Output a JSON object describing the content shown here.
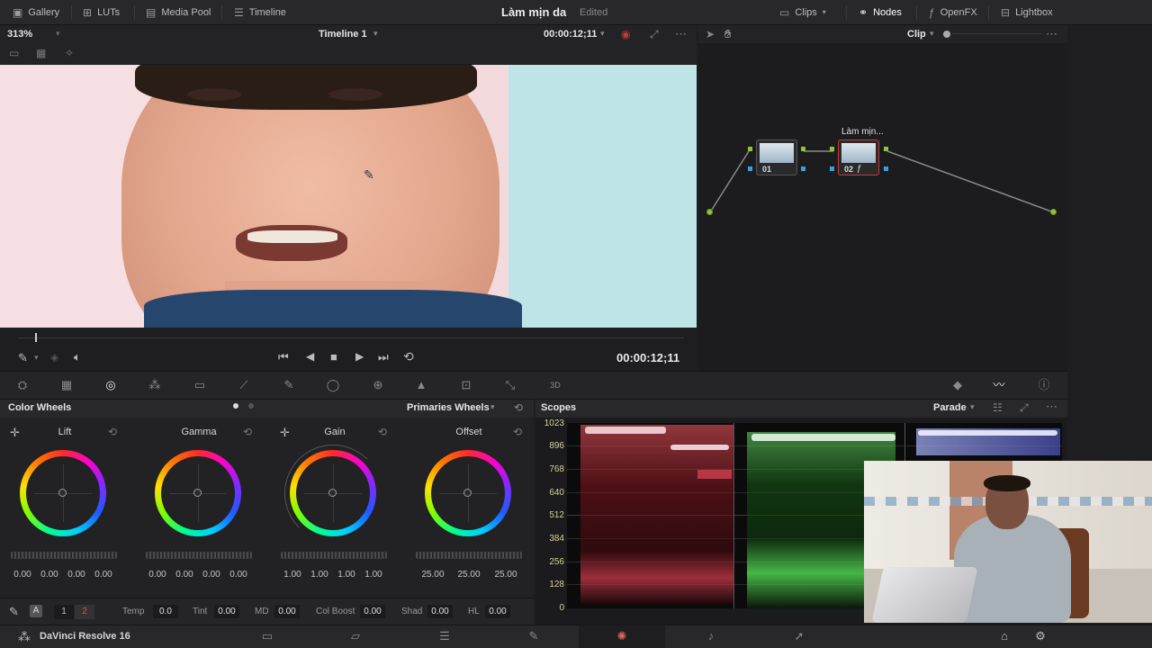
{
  "topbar": {
    "gallery": "Gallery",
    "luts": "LUTs",
    "media_pool": "Media Pool",
    "timeline": "Timeline",
    "project_title": "Làm mịn da",
    "edited": "Edited",
    "clips": "Clips",
    "nodes": "Nodes",
    "openfx": "OpenFX",
    "lightbox": "Lightbox"
  },
  "viewer": {
    "zoom": "313%",
    "timeline_name": "Timeline 1",
    "timecode_top": "00:00:12;11",
    "timecode": "00:00:12;11"
  },
  "nodes": {
    "mode": "Clip",
    "node1_label": "01",
    "node2_label": "02",
    "node2_title": "Làm mịn..."
  },
  "color_wheels": {
    "title": "Color Wheels",
    "mode": "Primaries Wheels",
    "wheels": [
      {
        "name": "Lift",
        "values": [
          "0.00",
          "0.00",
          "0.00",
          "0.00"
        ]
      },
      {
        "name": "Gamma",
        "values": [
          "0.00",
          "0.00",
          "0.00",
          "0.00"
        ]
      },
      {
        "name": "Gain",
        "values": [
          "1.00",
          "1.00",
          "1.00",
          "1.00"
        ]
      },
      {
        "name": "Offset",
        "values": [
          "25.00",
          "25.00",
          "25.00"
        ]
      }
    ]
  },
  "footer_params": {
    "page1": "1",
    "page2": "2",
    "temp_label": "Temp",
    "temp": "0.0",
    "tint_label": "Tint",
    "tint": "0.00",
    "md_label": "MD",
    "md": "0.00",
    "colboost_label": "Col Boost",
    "colboost": "0.00",
    "shad_label": "Shad",
    "shad": "0.00",
    "hl_label": "HL",
    "hl": "0.00"
  },
  "scopes": {
    "title": "Scopes",
    "mode": "Parade",
    "y_ticks": [
      "1023",
      "896",
      "768",
      "640",
      "512",
      "384",
      "256",
      "128",
      "0"
    ]
  },
  "app": {
    "name": "DaVinci Resolve 16"
  },
  "colors": {
    "accent_red": "#c33a3a",
    "node_green": "#8fc33a",
    "node_blue": "#3aa0e0"
  }
}
